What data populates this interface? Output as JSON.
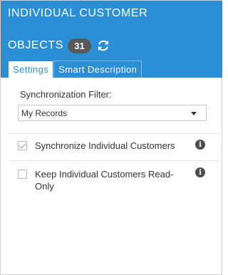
{
  "header": {
    "title_line1": "Individual Customer",
    "title_line2": "Objects",
    "count": "31",
    "refresh_icon": "refresh-icon",
    "background_color": "#2b8fd6"
  },
  "tabs": [
    {
      "label": "Settings",
      "active": true
    },
    {
      "label": "Smart Description",
      "active": false
    }
  ],
  "filter": {
    "label": "Synchronization Filter:",
    "selected": "My Records"
  },
  "options": [
    {
      "label": "Synchronize Individual Customers",
      "checked": true,
      "info_icon": "info-icon"
    },
    {
      "label": "Keep Individual Customers Read-Only",
      "checked": false,
      "info_icon": "info-icon"
    }
  ]
}
